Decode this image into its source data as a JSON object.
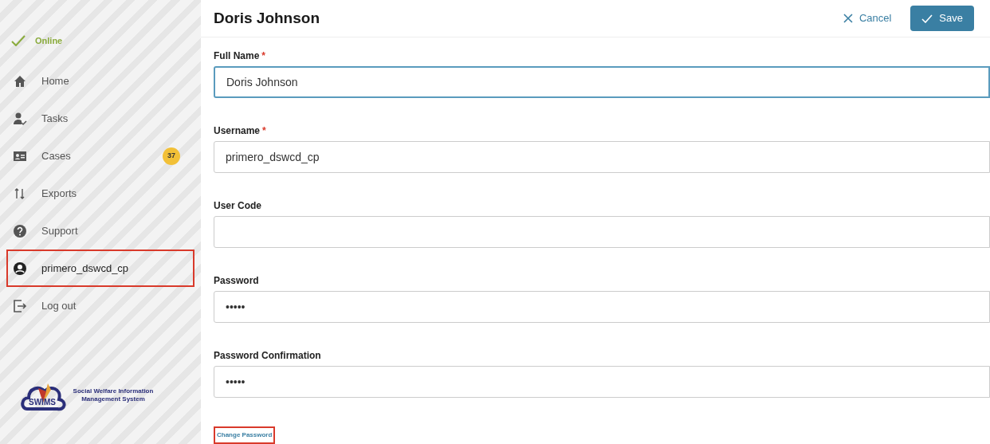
{
  "status": {
    "label": "Online",
    "online": true
  },
  "nav": [
    {
      "kind": "home",
      "label": "Home",
      "highlighted": false
    },
    {
      "kind": "tasks",
      "label": "Tasks",
      "highlighted": false
    },
    {
      "kind": "cases",
      "label": "Cases",
      "badge": "37",
      "highlighted": false
    },
    {
      "kind": "exports",
      "label": "Exports",
      "highlighted": false
    },
    {
      "kind": "support",
      "label": "Support",
      "highlighted": false
    },
    {
      "kind": "user",
      "label": "primero_dswcd_cp",
      "highlighted": true
    },
    {
      "kind": "logout",
      "label": "Log out",
      "highlighted": false
    }
  ],
  "logo": {
    "abbr": "SWIMS",
    "tagline": "Social Welfare Information Management System"
  },
  "header": {
    "title": "Doris Johnson",
    "cancel": "Cancel",
    "save": "Save"
  },
  "fields": [
    {
      "label": "Full Name",
      "required_mark": "*",
      "value": "Doris Johnson",
      "focused": true
    },
    {
      "label": "Username",
      "required_mark": "*",
      "value": "primero_dswcd_cp",
      "focused": false
    },
    {
      "label": "User Code",
      "focused": false
    },
    {
      "label": "Password",
      "value": "•••••",
      "focused": false
    },
    {
      "label": "Password Confirmation",
      "value": "•••••",
      "focused": false
    }
  ],
  "change_password": {
    "label": "Change Password",
    "highlighted": true
  }
}
